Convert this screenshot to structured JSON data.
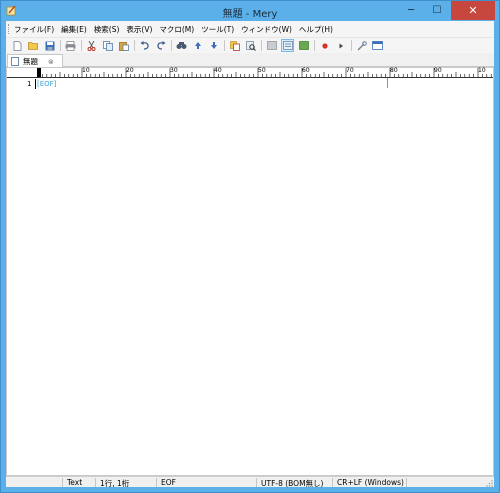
{
  "window": {
    "title": "無題 - Mery",
    "buttons": {
      "minimize": "─",
      "maximize": "☐",
      "close": "✕"
    }
  },
  "menu": [
    "ファイル(F)",
    "編集(E)",
    "検索(S)",
    "表示(V)",
    "マクロ(M)",
    "ツール(T)",
    "ウィンドウ(W)",
    "ヘルプ(H)"
  ],
  "toolbar": {
    "icons": [
      "new-file-icon",
      "open-folder-icon",
      "save-icon",
      "print-icon",
      "cut-icon",
      "copy-icon",
      "paste-icon",
      "undo-icon",
      "redo-icon",
      "find-icon",
      "find-prev-icon",
      "find-next-icon",
      "replace-icon",
      "search-files-icon",
      "view-mode-1-icon",
      "view-mode-2-icon",
      "view-mode-3-icon",
      "record-macro-icon",
      "run-macro-icon",
      "customize-icon",
      "toolbar-options-icon"
    ]
  },
  "tab": {
    "label": "無題",
    "close": "⊗"
  },
  "ruler": {
    "labels": [
      "10",
      "20",
      "30",
      "40",
      "50",
      "60",
      "70",
      "80",
      "90",
      "10"
    ]
  },
  "editor": {
    "line_number": "1",
    "eof_marker": "[EOF]"
  },
  "status": {
    "mode": "Text",
    "position": "1行, 1桁",
    "state": "EOF",
    "encoding": "UTF-8 (BOM無し)",
    "line_ending": "CR+LF (Windows)"
  },
  "colors": {
    "titlebar": "#5bb0ea",
    "close_button": "#c7463d",
    "eof": "#3aa4d8"
  }
}
